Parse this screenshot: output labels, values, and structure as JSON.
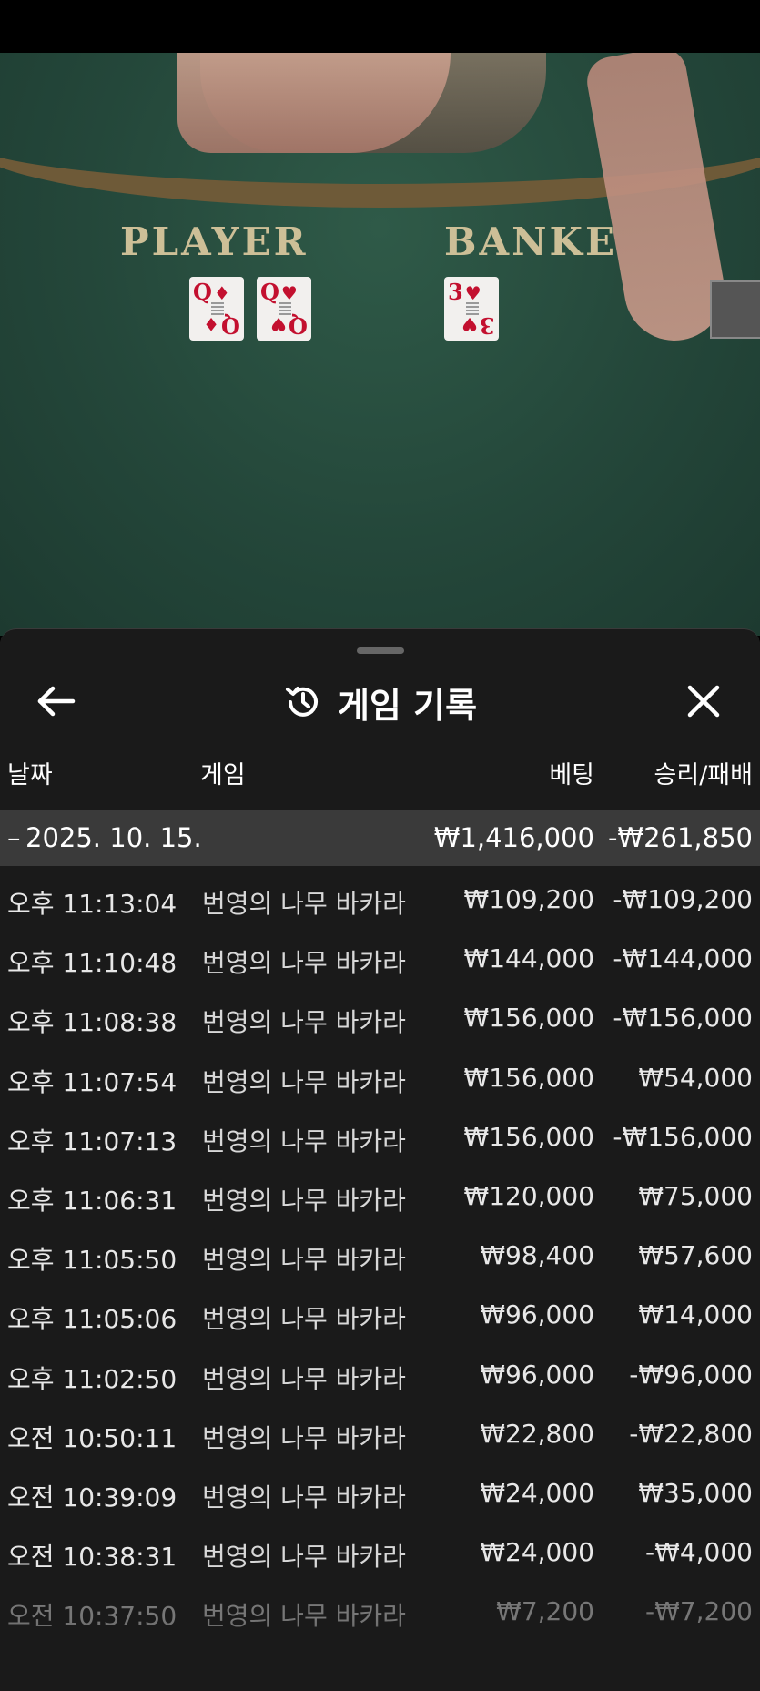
{
  "video": {
    "player_label": "PLAYER",
    "banker_label": "BANKE",
    "player_cards": [
      {
        "rank": "Q",
        "suit": "♦"
      },
      {
        "rank": "Q",
        "suit": "♥"
      }
    ],
    "banker_cards": [
      {
        "rank": "3",
        "suit": "♥"
      }
    ]
  },
  "header": {
    "title": "게임 기록",
    "back_icon": "arrow-left-icon",
    "history_icon": "history-icon",
    "close_icon": "close-icon"
  },
  "columns": {
    "date": "날짜",
    "game": "게임",
    "bet": "베팅",
    "result": "승리/패배"
  },
  "date_group": {
    "toggle": "–",
    "date": "2025. 10. 15.",
    "total_bet": "₩1,416,000",
    "total_result": "-₩261,850"
  },
  "rows": [
    {
      "time": "오후 11:13:04",
      "game": "번영의 나무 바카라",
      "bet": "₩109,200",
      "result": "-₩109,200"
    },
    {
      "time": "오후 11:10:48",
      "game": "번영의 나무 바카라",
      "bet": "₩144,000",
      "result": "-₩144,000"
    },
    {
      "time": "오후 11:08:38",
      "game": "번영의 나무 바카라",
      "bet": "₩156,000",
      "result": "-₩156,000"
    },
    {
      "time": "오후 11:07:54",
      "game": "번영의 나무 바카라",
      "bet": "₩156,000",
      "result": "₩54,000"
    },
    {
      "time": "오후 11:07:13",
      "game": "번영의 나무 바카라",
      "bet": "₩156,000",
      "result": "-₩156,000"
    },
    {
      "time": "오후 11:06:31",
      "game": "번영의 나무 바카라",
      "bet": "₩120,000",
      "result": "₩75,000"
    },
    {
      "time": "오후 11:05:50",
      "game": "번영의 나무 바카라",
      "bet": "₩98,400",
      "result": "₩57,600"
    },
    {
      "time": "오후 11:05:06",
      "game": "번영의 나무 바카라",
      "bet": "₩96,000",
      "result": "₩14,000"
    },
    {
      "time": "오후 11:02:50",
      "game": "번영의 나무 바카라",
      "bet": "₩96,000",
      "result": "-₩96,000"
    },
    {
      "time": "오전 10:50:11",
      "game": "번영의 나무 바카라",
      "bet": "₩22,800",
      "result": "-₩22,800"
    },
    {
      "time": "오전 10:39:09",
      "game": "번영의 나무 바카라",
      "bet": "₩24,000",
      "result": "₩35,000"
    },
    {
      "time": "오전 10:38:31",
      "game": "번영의 나무 바카라",
      "bet": "₩24,000",
      "result": "-₩4,000"
    },
    {
      "time": "오전 10:37:50",
      "game": "번영의 나무 바카라",
      "bet": "₩7,200",
      "result": "-₩7,200"
    }
  ]
}
